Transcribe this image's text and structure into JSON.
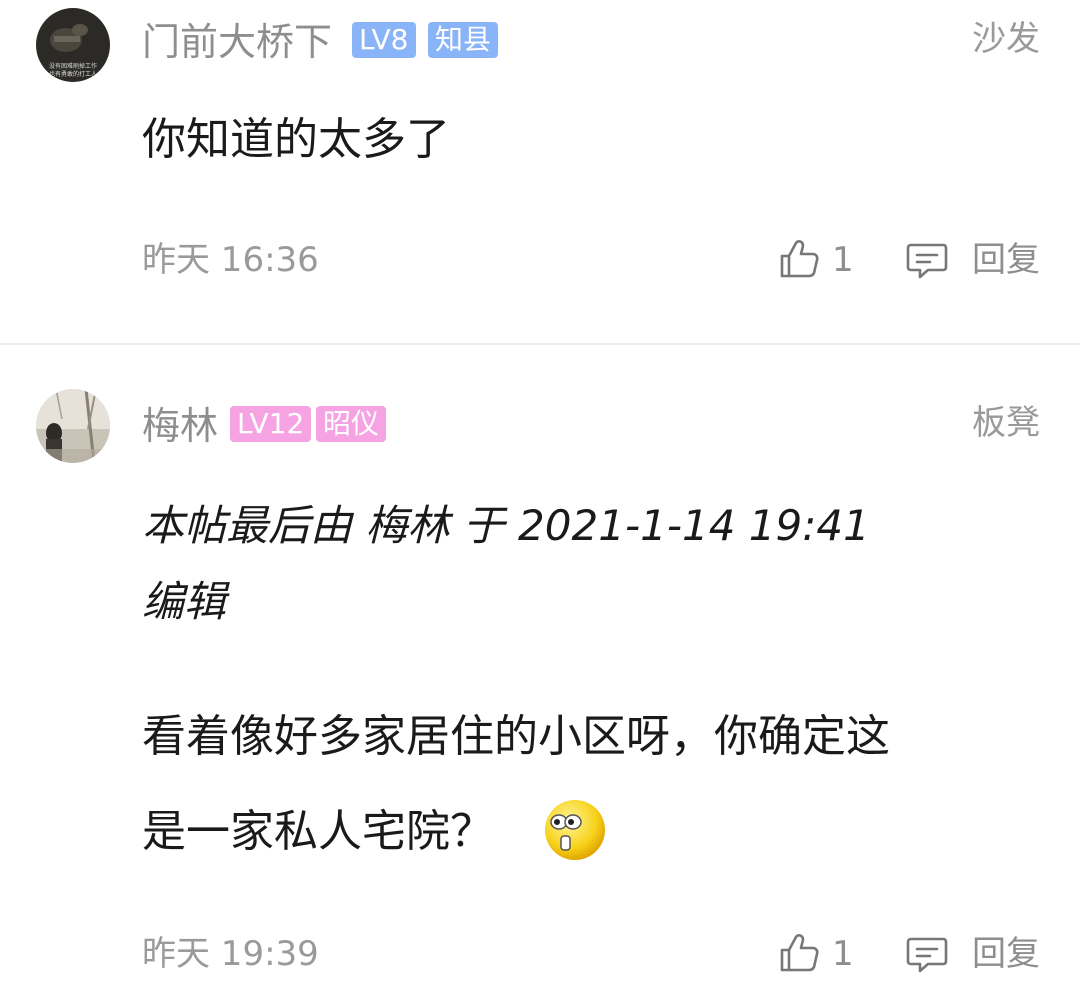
{
  "posts": [
    {
      "username": "门前大桥下",
      "level": "LV8",
      "rank": "知县",
      "level_color": "#8ab4f8",
      "rank_color": "#8ab4f8",
      "floor": "沙发",
      "avatar_caption_line1": "没有困难刷掉工作",
      "avatar_caption_line2": "也有勇敢的打工人",
      "content_lines": [
        "你知道的太多了"
      ],
      "time": "昨天 16:36",
      "likes": "1",
      "reply_label": "回复"
    },
    {
      "username": "梅林",
      "level": "LV12",
      "rank": "昭仪",
      "level_color": "#f5a3e3",
      "rank_color": "#f5a3e3",
      "floor": "板凳",
      "edited_lines": [
        "本帖最后由 梅林 于 2021-1-14 19:41",
        "编辑"
      ],
      "content_lines": [
        "看着像好多家居住的小区呀，你确定这",
        "是一家私人宅院？"
      ],
      "emoji": "surprised-face-emoji",
      "time": "昨天 19:39",
      "likes": "1",
      "reply_label": "回复"
    }
  ],
  "icons": {
    "like": "thumbs-up-icon",
    "reply": "comment-bubble-icon"
  }
}
